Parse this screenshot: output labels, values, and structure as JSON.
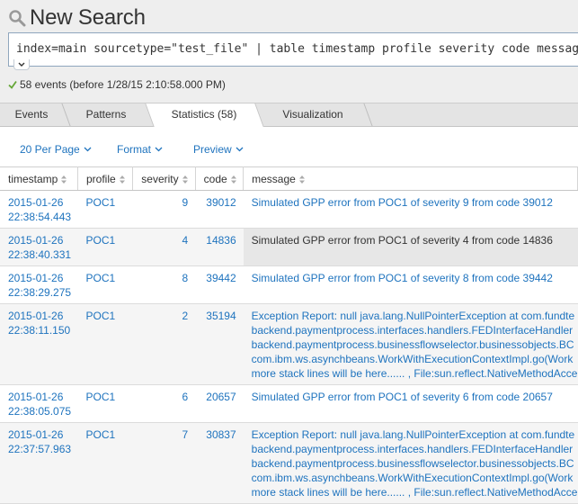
{
  "header": {
    "title": "New Search",
    "query": "index=main sourcetype=\"test_file\" | table timestamp profile severity code message",
    "status": "58 events (before 1/28/15 2:10:58.000 PM)"
  },
  "tabs": [
    {
      "label": "Events"
    },
    {
      "label": "Patterns"
    },
    {
      "label": "Statistics (58)"
    },
    {
      "label": "Visualization"
    }
  ],
  "toolbar": {
    "per_page": "20 Per Page",
    "format": "Format",
    "preview": "Preview"
  },
  "table": {
    "columns": [
      "timestamp",
      "profile",
      "severity",
      "code",
      "message"
    ],
    "rows": [
      {
        "date": "2015-01-26",
        "time": "22:38:54.443",
        "profile": "POC1",
        "severity": "9",
        "code": "39012",
        "message": [
          "Simulated GPP error from POC1 of severity 9 from code 39012"
        ]
      },
      {
        "date": "2015-01-26",
        "time": "22:38:40.331",
        "profile": "POC1",
        "severity": "4",
        "code": "14836",
        "message": [
          "Simulated GPP error from POC1 of severity 4 from code 14836"
        ]
      },
      {
        "date": "2015-01-26",
        "time": "22:38:29.275",
        "profile": "POC1",
        "severity": "8",
        "code": "39442",
        "message": [
          "Simulated GPP error from POC1 of severity 8 from code 39442"
        ]
      },
      {
        "date": "2015-01-26",
        "time": "22:38:11.150",
        "profile": "POC1",
        "severity": "2",
        "code": "35194",
        "message": [
          "Exception Report: null java.lang.NullPointerException at com.fundte",
          "backend.paymentprocess.interfaces.handlers.FEDInterfaceHandler",
          "backend.paymentprocess.businessflowselector.businessobjects.BC",
          "com.ibm.ws.asynchbeans.WorkWithExecutionContextImpl.go(Work",
          "more stack lines will be here...... , File:sun.reflect.NativeMethodAcce"
        ]
      },
      {
        "date": "2015-01-26",
        "time": "22:38:05.075",
        "profile": "POC1",
        "severity": "6",
        "code": "20657",
        "message": [
          "Simulated GPP error from POC1 of severity 6 from code 20657"
        ]
      },
      {
        "date": "2015-01-26",
        "time": "22:37:57.963",
        "profile": "POC1",
        "severity": "7",
        "code": "30837",
        "message": [
          "Exception Report: null java.lang.NullPointerException at com.fundte",
          "backend.paymentprocess.interfaces.handlers.FEDInterfaceHandler",
          "backend.paymentprocess.businessflowselector.businessobjects.BC",
          "com.ibm.ws.asynchbeans.WorkWithExecutionContextImpl.go(Work",
          "more stack lines will be here...... , File:sun.reflect.NativeMethodAcce"
        ]
      }
    ]
  },
  "colors": {
    "link": "#1e73be",
    "check": "#65a637",
    "header_bg": "#eeeeee",
    "tabs_bg": "#e4e4e4",
    "row_alt": "#f5f5f5",
    "highlight": "#e7e7e7"
  },
  "icons": [
    "search-icon",
    "checkmark-icon",
    "chevron-down-icon",
    "sort-icon"
  ]
}
